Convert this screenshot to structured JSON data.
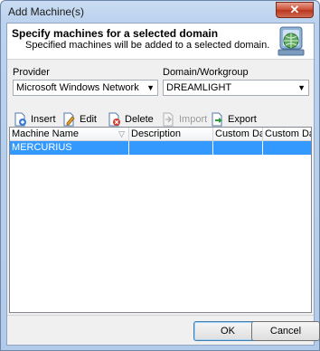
{
  "window": {
    "title": "Add Machine(s)",
    "close_glyph": "✕"
  },
  "header": {
    "title": "Specify machines for a selected domain",
    "subtitle": "Specified machines will be added to a selected domain.",
    "logo_icon": "network-globe-icon"
  },
  "provider": {
    "label": "Provider",
    "value": "Microsoft Windows Network"
  },
  "domain": {
    "label": "Domain/Workgroup",
    "value": "DREAMLIGHT"
  },
  "toolbar": {
    "insert": "Insert",
    "edit": "Edit",
    "delete": "Delete",
    "import": "Import",
    "export": "Export"
  },
  "grid": {
    "columns": [
      "Machine Name",
      "Description",
      "Custom Dat...",
      "Custom Dat..."
    ],
    "rows": [
      {
        "machine_name": "MERCURIUS",
        "description": "",
        "custom1": "",
        "custom2": ""
      }
    ]
  },
  "buttons": {
    "ok": "OK",
    "cancel": "Cancel"
  },
  "colors": {
    "selection": "#3399ff",
    "titlebar": "#bcd2ee",
    "close": "#c84b32"
  }
}
